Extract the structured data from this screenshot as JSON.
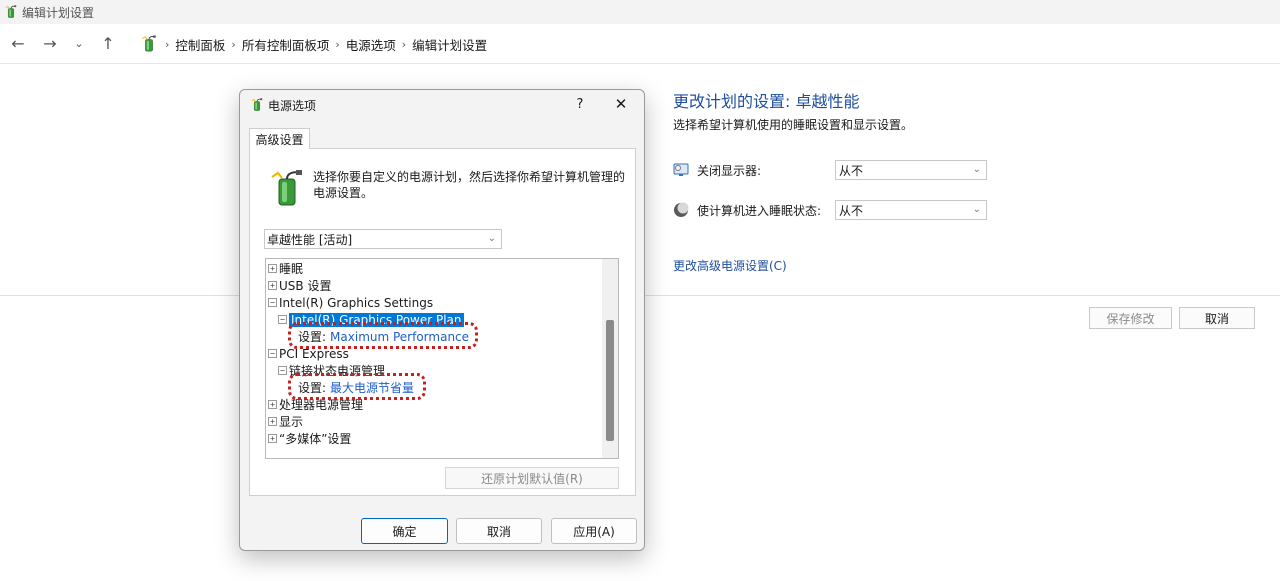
{
  "window": {
    "title": "编辑计划设置"
  },
  "nav": {
    "back": "←",
    "forward": "→",
    "recent": "⌄",
    "up": "↑",
    "separator": "›",
    "breadcrumbs": [
      "控制面板",
      "所有控制面板项",
      "电源选项",
      "编辑计划设置"
    ]
  },
  "page": {
    "heading": "更改计划的设置: 卓越性能",
    "description": "选择希望计算机使用的睡眠设置和显示设置。",
    "rows": [
      {
        "label": "关闭显示器:",
        "value": "从不",
        "icon": "monitor-icon"
      },
      {
        "label": "使计算机进入睡眠状态:",
        "value": "从不",
        "icon": "moon-icon"
      }
    ],
    "advanced_link": "更改高级电源设置(C)",
    "save_button": "保存修改",
    "cancel_button": "取消"
  },
  "dialog": {
    "title": "电源选项",
    "help": "?",
    "close": "✕",
    "tab": "高级设置",
    "intro": "选择你要自定义的电源计划，然后选择你希望计算机管理的电源设置。",
    "plan": "卓越性能 [活动]",
    "tree": [
      {
        "exp": "+",
        "label": "睡眠"
      },
      {
        "exp": "+",
        "label": "USB 设置"
      },
      {
        "exp": "−",
        "label": "Intel(R) Graphics Settings"
      },
      {
        "exp": "−",
        "label": "Intel(R) Graphics Power Plan"
      },
      {
        "setting_label": "设置:",
        "setting_value": "Maximum Performance"
      },
      {
        "exp": "−",
        "label": "PCI Express"
      },
      {
        "exp": "−",
        "label": "链接状态电源管理"
      },
      {
        "setting_label": "设置:",
        "setting_value": "最大电源节省量"
      },
      {
        "exp": "+",
        "label": "处理器电源管理"
      },
      {
        "exp": "+",
        "label": "显示"
      },
      {
        "exp": "+",
        "label": "“多媒体”设置"
      }
    ],
    "restore_button": "还原计划默认值(R)",
    "ok_button": "确定",
    "cancel_button": "取消",
    "apply_button": "应用(A)"
  },
  "colors": {
    "link_blue": "#1f4e9c",
    "selection": "#0078d7",
    "annotation_red": "#c71e1e"
  }
}
